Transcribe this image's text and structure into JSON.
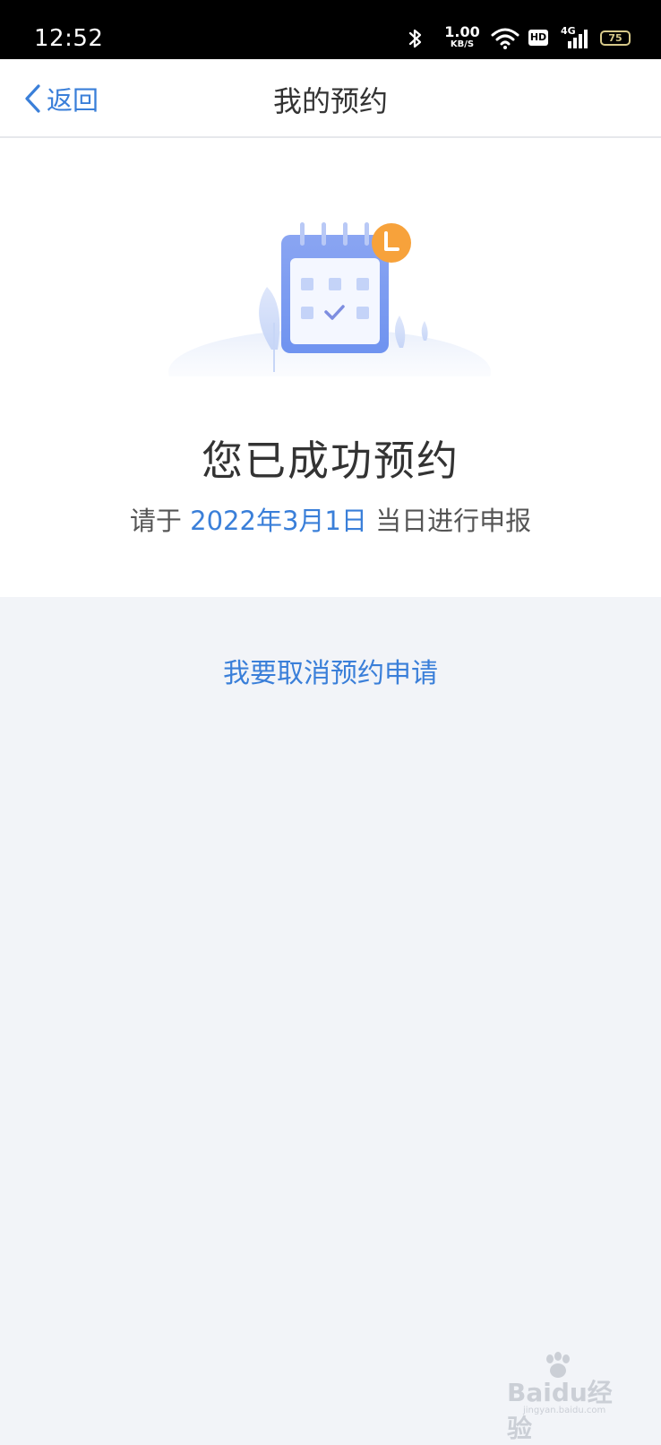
{
  "status_bar": {
    "time": "12:52",
    "net_speed_value": "1.00",
    "net_speed_unit": "KB/S",
    "hd_label": "HD",
    "signal_label": "4G",
    "battery": "75"
  },
  "nav": {
    "back_label": "返回",
    "title": "我的预约"
  },
  "result": {
    "title": "您已成功预约",
    "sub_prefix": "请于 ",
    "date": "2022年3月1日",
    "sub_suffix": " 当日进行申报"
  },
  "actions": {
    "cancel_label": "我要取消预约申请"
  },
  "watermark": {
    "text": "Baidu经验",
    "sub": "jingyan.baidu.com"
  },
  "colors": {
    "accent": "#3a7fd9",
    "page_bg": "#f2f4f8",
    "badge_orange": "#f7a23b",
    "calendar_blue": "#6f93f0"
  },
  "icons": [
    "bluetooth-icon",
    "wifi-icon",
    "signal-icon",
    "battery-icon",
    "chevron-left-icon",
    "calendar-check-icon",
    "clock-badge-icon"
  ]
}
